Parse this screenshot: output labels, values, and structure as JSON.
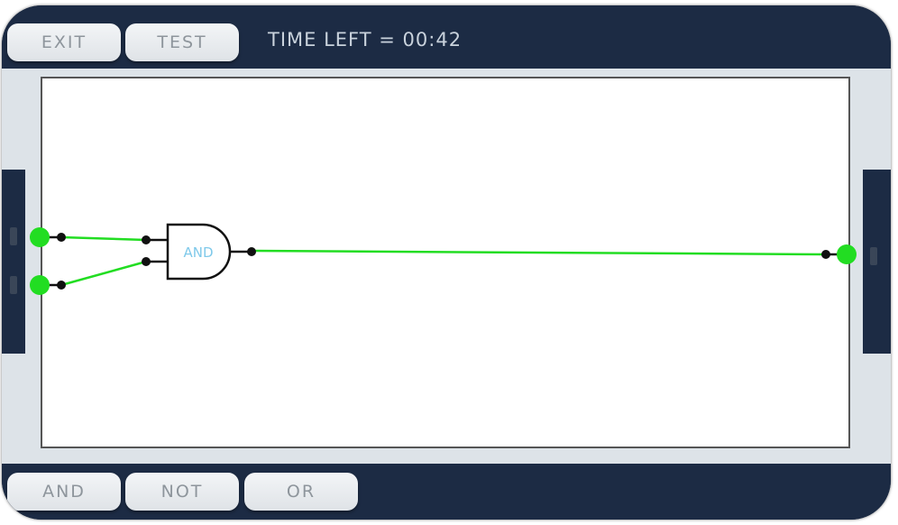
{
  "toolbar": {
    "exit_label": "EXIT",
    "test_label": "TEST",
    "timer_text": "TIME LEFT = 00:42"
  },
  "circuit": {
    "gate_label": "AND",
    "wire_color": "#22dd22",
    "terminal_color": "#22dd22"
  },
  "palette": {
    "and_label": "AND",
    "not_label": "NOT",
    "or_label": "OR"
  },
  "colors": {
    "panel": "#1c2b44",
    "workspace": "#dde3e8",
    "gate_text": "#7fc9ea"
  }
}
